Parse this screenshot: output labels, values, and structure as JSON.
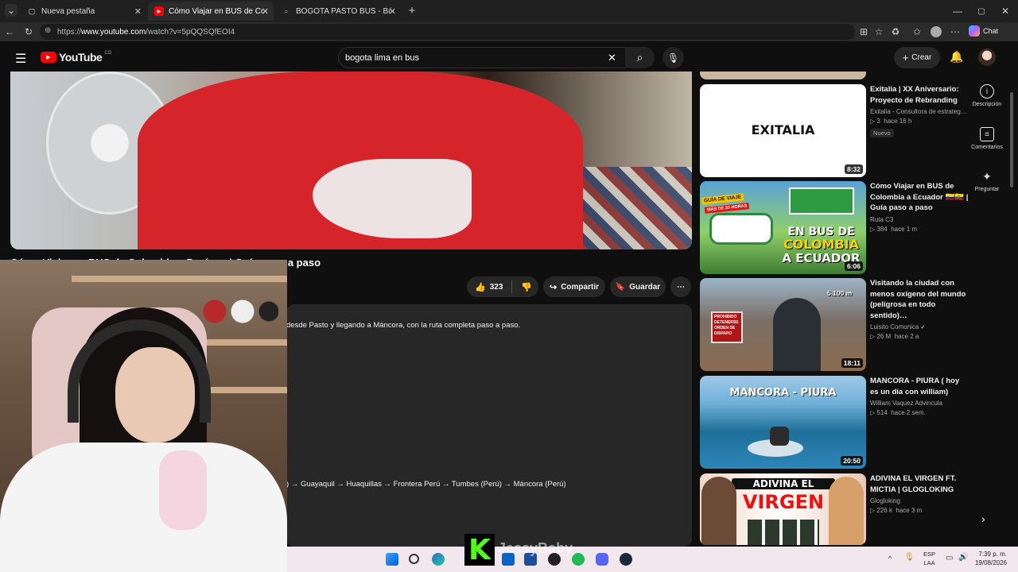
{
  "browser": {
    "tabs": [
      {
        "label": "Nueva pestaña",
        "active": false
      },
      {
        "label": "Cómo Viajar en BUS de Colombia",
        "active": true
      },
      {
        "label": "BOGOTA PASTO BUS - Búsqueda",
        "active": false
      }
    ],
    "url_prefix": "https://",
    "url_domain": "www.youtube.com",
    "url_path": "/watch?v=5pQQSQfEOI4",
    "chat_label": "Chat"
  },
  "youtube": {
    "logo_text": "YouTube",
    "region": "CO",
    "search_value": "bogota lima en bus",
    "create_label": "Crear"
  },
  "video": {
    "title_visible": "Cómo Viajar en BUS de Colombia a Perú",
    "title_suffix": "| Guía paso a paso",
    "like_count": "323",
    "share_label": "Compartir",
    "save_label": "Guardar",
    "desc_line1": "desde Pasto y llegando a Máncora, con la ruta completa paso a paso.",
    "desc_line2": ") → Guayaquil → Huaquillas → Frontera Perú → Tumbes (Perú) → Máncora (Perú)"
  },
  "recommendations": [
    {
      "title": "Exitalia | XX Aniversario: Proyecto de Rebranding",
      "channel": "Exitalia - Consultora de estrateg…",
      "views": "3",
      "age": "hace 16 h",
      "badge": "Nuevo",
      "duration": "8:32",
      "thumb_text": "EXITALIA"
    },
    {
      "title": "Cómo Viajar en BUS de Colombia a Ecuador 🇨🇴🇪🇨 | Guía paso a paso",
      "channel": "Ruta C3",
      "views": "384",
      "age": "hace 1 m",
      "duration": "6:06",
      "thumb_text1": "GUÍA DE VIAJE",
      "thumb_text2": "MÁS DE 20 HORAS",
      "thumb_text3": "EN BUS DE",
      "thumb_text4": "COLOMBIA",
      "thumb_text5": "A ECUADOR"
    },
    {
      "title": "Visitando la ciudad con menos oxígeno del mundo (peligrosa en todo sentido)…",
      "channel": "Luisito Comunica",
      "views": "26 M",
      "age": "hace 2 a",
      "duration": "18:11",
      "thumb_text1": "5.100 m",
      "thumb_text2": "PROHIBIDO DETENERSE ORDEN DE DISPARO"
    },
    {
      "title": "MANCORA - PIURA ( hoy es un dia con william)",
      "channel": "William Vaquez Advincula",
      "views": "514",
      "age": "hace 2 sem.",
      "duration": "20:50",
      "thumb_text": "MANCORA - PIURA"
    },
    {
      "title": "ADIVINA EL VIRGEN FT. MICTIA | GLOGLOKING",
      "channel": "Glogloking",
      "views": "226 k",
      "age": "hace 3 m",
      "thumb_text1": "ADIVINA EL",
      "thumb_text2": "VIRGEN"
    }
  ],
  "side_panel": [
    {
      "label": "Descripción",
      "icon": "info-icon"
    },
    {
      "label": "Comentarios",
      "icon": "comment-icon"
    },
    {
      "label": "Preguntar",
      "icon": "sparkle-icon"
    }
  ],
  "taskbar": {
    "lang_top": "ESP",
    "lang_bottom": "LAA",
    "time": "7:39 p. m.",
    "date": "19/08/2026"
  },
  "overlay": {
    "k_letter": "K",
    "streamer_name": "JessyBaby"
  }
}
